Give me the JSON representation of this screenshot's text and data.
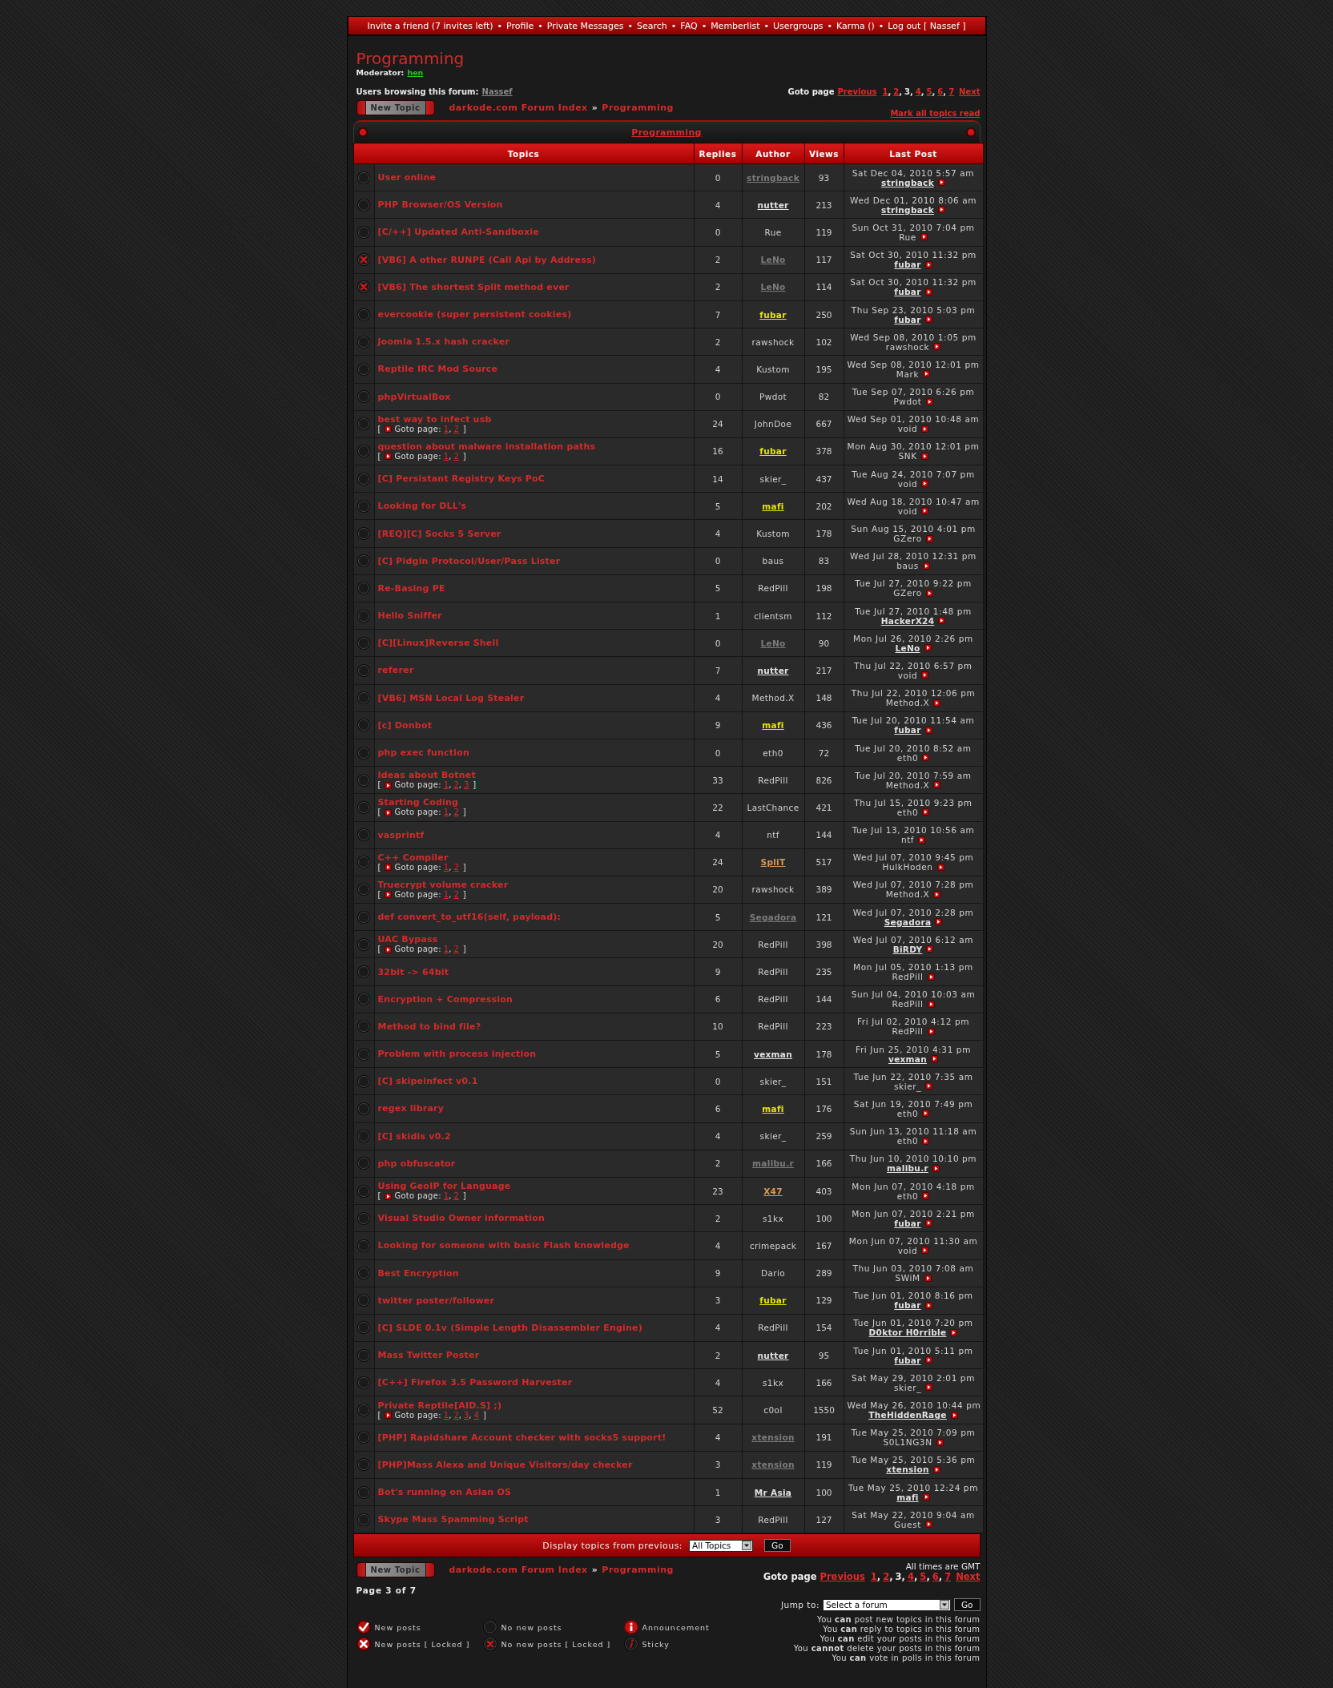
{
  "top_nav": {
    "separator": "•",
    "links": [
      "Invite a friend (7 invites left)",
      "Profile",
      "Private Messages",
      "Search",
      "FAQ",
      "Memberlist",
      "Usergroups",
      "Karma ()",
      "Log out [ Nassef ]"
    ]
  },
  "forum": {
    "title": "Programming",
    "moderator_label": "Moderator:",
    "moderator": "hen",
    "browsing_label": "Users browsing this forum:",
    "browsing_users": [
      "Nassef"
    ]
  },
  "pagination_top": {
    "label": "Goto page",
    "previous": "Previous",
    "separator": ",",
    "pages": [
      {
        "label": "1",
        "selected": false
      },
      {
        "label": "2",
        "selected": false
      },
      {
        "label": "3",
        "selected": true
      },
      {
        "label": "4",
        "selected": false
      },
      {
        "label": "5",
        "selected": false
      },
      {
        "label": "6",
        "selected": false
      },
      {
        "label": "7",
        "selected": false
      }
    ],
    "next": "Next"
  },
  "toolbar_top": {
    "new_topic": "New Topic",
    "breadcrumb": {
      "separator": "»",
      "items": [
        "darkode.com Forum Index",
        "Programming"
      ]
    },
    "mark_read": "Mark all topics read"
  },
  "table": {
    "category": "Programming",
    "columns": [
      "Topics",
      "Replies",
      "Author",
      "Views",
      "Last Post"
    ],
    "rows": [
      {
        "title": "User online",
        "locked": false,
        "replies": "0",
        "author": {
          "name": "stringback",
          "linked": true,
          "color": "#7c7c7c"
        },
        "views": "93",
        "last_post": {
          "time": "Sat Dec 04, 2010 5:57 am",
          "by": "stringback",
          "linked": true
        }
      },
      {
        "title": "PHP Browser/OS Version",
        "locked": false,
        "replies": "4",
        "author": {
          "name": "nutter",
          "linked": true,
          "color": "#e2e2e2"
        },
        "views": "213",
        "last_post": {
          "time": "Wed Dec 01, 2010 8:06 am",
          "by": "stringback",
          "linked": true
        }
      },
      {
        "title": "[C/++] Updated Anti-Sandboxie",
        "locked": false,
        "replies": "0",
        "author": {
          "name": "Rue",
          "linked": false
        },
        "views": "119",
        "last_post": {
          "time": "Sun Oct 31, 2010 7:04 pm",
          "by": "Rue",
          "linked": false
        }
      },
      {
        "title": "[VB6] A other RUNPE (Call Api by Address)",
        "locked": true,
        "replies": "2",
        "author": {
          "name": "LeNo",
          "linked": true,
          "color": "#7c7c7c"
        },
        "views": "117",
        "last_post": {
          "time": "Sat Oct 30, 2010 11:32 pm",
          "by": "fubar",
          "linked": true
        }
      },
      {
        "title": "[VB6] The shortest Split method ever",
        "locked": true,
        "replies": "2",
        "author": {
          "name": "LeNo",
          "linked": true,
          "color": "#7c7c7c"
        },
        "views": "114",
        "last_post": {
          "time": "Sat Oct 30, 2010 11:32 pm",
          "by": "fubar",
          "linked": true
        }
      },
      {
        "title": "evercookie (super persistent cookies)",
        "locked": false,
        "replies": "7",
        "author": {
          "name": "fubar",
          "linked": true,
          "color": "#e6e600"
        },
        "views": "250",
        "last_post": {
          "time": "Thu Sep 23, 2010 5:03 pm",
          "by": "fubar",
          "linked": true
        }
      },
      {
        "title": "Joomla 1.5.x hash cracker",
        "locked": false,
        "replies": "2",
        "author": {
          "name": "rawshock",
          "linked": false
        },
        "views": "102",
        "last_post": {
          "time": "Wed Sep 08, 2010 1:05 pm",
          "by": "rawshock",
          "linked": false
        }
      },
      {
        "title": "Reptile IRC Mod Source",
        "locked": false,
        "replies": "4",
        "author": {
          "name": "Kustom",
          "linked": false
        },
        "views": "195",
        "last_post": {
          "time": "Wed Sep 08, 2010 12:01 pm",
          "by": "Mark",
          "linked": false
        }
      },
      {
        "title": "phpVirtualBox",
        "locked": false,
        "replies": "0",
        "author": {
          "name": "Pwdot",
          "linked": false
        },
        "views": "82",
        "last_post": {
          "time": "Tue Sep 07, 2010 6:26 pm",
          "by": "Pwdot",
          "linked": false
        }
      },
      {
        "title": "best way to infect usb",
        "locked": false,
        "pagination": {
          "open": "[",
          "label": "Goto page:",
          "separator": ",",
          "pages": [
            "1",
            "2"
          ],
          "close": "]"
        },
        "replies": "24",
        "author": {
          "name": "JohnDoe",
          "linked": false
        },
        "views": "667",
        "last_post": {
          "time": "Wed Sep 01, 2010 10:48 am",
          "by": "void",
          "linked": false
        }
      },
      {
        "title": "question about malware installation paths",
        "locked": false,
        "pagination": {
          "open": "[",
          "label": "Goto page:",
          "separator": ",",
          "pages": [
            "1",
            "2"
          ],
          "close": "]"
        },
        "replies": "16",
        "author": {
          "name": "fubar",
          "linked": true,
          "color": "#e6e600"
        },
        "views": "378",
        "last_post": {
          "time": "Mon Aug 30, 2010 12:01 pm",
          "by": "SNK",
          "linked": false
        }
      },
      {
        "title": "[C] Persistant Registry Keys PoC",
        "locked": false,
        "replies": "14",
        "author": {
          "name": "skier_",
          "linked": false
        },
        "views": "437",
        "last_post": {
          "time": "Tue Aug 24, 2010 7:07 pm",
          "by": "void",
          "linked": false
        }
      },
      {
        "title": "Looking for DLL's",
        "locked": false,
        "replies": "5",
        "author": {
          "name": "mafi",
          "linked": true,
          "color": "#e6e600"
        },
        "views": "202",
        "last_post": {
          "time": "Wed Aug 18, 2010 10:47 am",
          "by": "void",
          "linked": false
        }
      },
      {
        "title": "[REQ][C] Socks 5 Server",
        "locked": false,
        "replies": "4",
        "author": {
          "name": "Kustom",
          "linked": false
        },
        "views": "178",
        "last_post": {
          "time": "Sun Aug 15, 2010 4:01 pm",
          "by": "GZero",
          "linked": false
        }
      },
      {
        "title": "[C] Pidgin Protocol/User/Pass Lister",
        "locked": false,
        "replies": "0",
        "author": {
          "name": "baus",
          "linked": false
        },
        "views": "83",
        "last_post": {
          "time": "Wed Jul 28, 2010 12:31 pm",
          "by": "baus",
          "linked": false
        }
      },
      {
        "title": "Re-Basing PE",
        "locked": false,
        "replies": "5",
        "author": {
          "name": "RedPill",
          "linked": false
        },
        "views": "198",
        "last_post": {
          "time": "Tue Jul 27, 2010 9:22 pm",
          "by": "GZero",
          "linked": false
        }
      },
      {
        "title": "Hello Sniffer",
        "locked": false,
        "replies": "1",
        "author": {
          "name": "clientsm",
          "linked": false
        },
        "views": "112",
        "last_post": {
          "time": "Tue Jul 27, 2010 1:48 pm",
          "by": "HackerX24",
          "linked": true
        }
      },
      {
        "title": "[C][Linux]Reverse Shell",
        "locked": false,
        "replies": "0",
        "author": {
          "name": "LeNo",
          "linked": true,
          "color": "#7c7c7c"
        },
        "views": "90",
        "last_post": {
          "time": "Mon Jul 26, 2010 2:26 pm",
          "by": "LeNo",
          "linked": true
        }
      },
      {
        "title": "referer",
        "locked": false,
        "replies": "7",
        "author": {
          "name": "nutter",
          "linked": true,
          "color": "#e2e2e2"
        },
        "views": "217",
        "last_post": {
          "time": "Thu Jul 22, 2010 6:57 pm",
          "by": "void",
          "linked": false
        }
      },
      {
        "title": "[VB6] MSN Local Log Stealer",
        "locked": false,
        "replies": "4",
        "author": {
          "name": "Method.X",
          "linked": false
        },
        "views": "148",
        "last_post": {
          "time": "Thu Jul 22, 2010 12:06 pm",
          "by": "Method.X",
          "linked": false
        }
      },
      {
        "title": "[c] Donbot",
        "locked": false,
        "replies": "9",
        "author": {
          "name": "mafi",
          "linked": true,
          "color": "#e6e600"
        },
        "views": "436",
        "last_post": {
          "time": "Tue Jul 20, 2010 11:54 am",
          "by": "fubar",
          "linked": true
        }
      },
      {
        "title": "php exec function",
        "locked": false,
        "replies": "0",
        "author": {
          "name": "eth0",
          "linked": false
        },
        "views": "72",
        "last_post": {
          "time": "Tue Jul 20, 2010 8:52 am",
          "by": "eth0",
          "linked": false
        }
      },
      {
        "title": "Ideas about Botnet",
        "locked": false,
        "pagination": {
          "open": "[",
          "label": "Goto page:",
          "separator": ",",
          "pages": [
            "1",
            "2",
            "3"
          ],
          "close": "]"
        },
        "replies": "33",
        "author": {
          "name": "RedPill",
          "linked": false
        },
        "views": "826",
        "last_post": {
          "time": "Tue Jul 20, 2010 7:59 am",
          "by": "Method.X",
          "linked": false
        }
      },
      {
        "title": "Starting Coding",
        "locked": false,
        "pagination": {
          "open": "[",
          "label": "Goto page:",
          "separator": ",",
          "pages": [
            "1",
            "2"
          ],
          "close": "]"
        },
        "replies": "22",
        "author": {
          "name": "LastChance",
          "linked": false
        },
        "views": "421",
        "last_post": {
          "time": "Thu Jul 15, 2010 9:23 pm",
          "by": "eth0",
          "linked": false
        }
      },
      {
        "title": "vasprintf",
        "locked": false,
        "replies": "4",
        "author": {
          "name": "ntf",
          "linked": false
        },
        "views": "144",
        "last_post": {
          "time": "Tue Jul 13, 2010 10:56 am",
          "by": "ntf",
          "linked": false
        }
      },
      {
        "title": "C++ Compiler",
        "locked": false,
        "pagination": {
          "open": "[",
          "label": "Goto page:",
          "separator": ",",
          "pages": [
            "1",
            "2"
          ],
          "close": "]"
        },
        "replies": "24",
        "author": {
          "name": "SpliT",
          "linked": true,
          "color": "#d49a58"
        },
        "views": "517",
        "last_post": {
          "time": "Wed Jul 07, 2010 9:45 pm",
          "by": "HulkHoden",
          "linked": false
        }
      },
      {
        "title": "Truecrypt volume cracker",
        "locked": false,
        "pagination": {
          "open": "[",
          "label": "Goto page:",
          "separator": ",",
          "pages": [
            "1",
            "2"
          ],
          "close": "]"
        },
        "replies": "20",
        "author": {
          "name": "rawshock",
          "linked": false
        },
        "views": "389",
        "last_post": {
          "time": "Wed Jul 07, 2010 7:28 pm",
          "by": "Method.X",
          "linked": false
        }
      },
      {
        "title": "def convert_to_utf16(self, payload):",
        "locked": false,
        "replies": "5",
        "author": {
          "name": "Segadora",
          "linked": true,
          "color": "#7c7c7c"
        },
        "views": "121",
        "last_post": {
          "time": "Wed Jul 07, 2010 2:28 pm",
          "by": "Segadora",
          "linked": true
        }
      },
      {
        "title": "UAC Bypass",
        "locked": false,
        "pagination": {
          "open": "[",
          "label": "Goto page:",
          "separator": ",",
          "pages": [
            "1",
            "2"
          ],
          "close": "]"
        },
        "replies": "20",
        "author": {
          "name": "RedPill",
          "linked": false
        },
        "views": "398",
        "last_post": {
          "time": "Wed Jul 07, 2010 6:12 am",
          "by": "BiRDY",
          "linked": true
        }
      },
      {
        "title": "32bit -> 64bit",
        "locked": false,
        "replies": "9",
        "author": {
          "name": "RedPill",
          "linked": false
        },
        "views": "235",
        "last_post": {
          "time": "Mon Jul 05, 2010 1:13 pm",
          "by": "RedPill",
          "linked": false
        }
      },
      {
        "title": "Encryption + Compression",
        "locked": false,
        "replies": "6",
        "author": {
          "name": "RedPill",
          "linked": false
        },
        "views": "144",
        "last_post": {
          "time": "Sun Jul 04, 2010 10:03 am",
          "by": "RedPill",
          "linked": false
        }
      },
      {
        "title": "Method to bind file?",
        "locked": false,
        "replies": "10",
        "author": {
          "name": "RedPill",
          "linked": false
        },
        "views": "223",
        "last_post": {
          "time": "Fri Jul 02, 2010 4:12 pm",
          "by": "RedPill",
          "linked": false
        }
      },
      {
        "title": "Problem with process injection",
        "locked": false,
        "replies": "5",
        "author": {
          "name": "vexman",
          "linked": true,
          "color": "#e2e2e2"
        },
        "views": "178",
        "last_post": {
          "time": "Fri Jun 25, 2010 4:31 pm",
          "by": "vexman",
          "linked": true
        }
      },
      {
        "title": "[C] skipeinfect v0.1",
        "locked": false,
        "replies": "0",
        "author": {
          "name": "skier_",
          "linked": false
        },
        "views": "151",
        "last_post": {
          "time": "Tue Jun 22, 2010 7:35 am",
          "by": "skier_",
          "linked": false
        }
      },
      {
        "title": "regex library",
        "locked": false,
        "replies": "6",
        "author": {
          "name": "mafi",
          "linked": true,
          "color": "#e6e600"
        },
        "views": "176",
        "last_post": {
          "time": "Sat Jun 19, 2010 7:49 pm",
          "by": "eth0",
          "linked": false
        }
      },
      {
        "title": "[C] skidis v0.2",
        "locked": false,
        "replies": "4",
        "author": {
          "name": "skier_",
          "linked": false
        },
        "views": "259",
        "last_post": {
          "time": "Sun Jun 13, 2010 11:18 am",
          "by": "eth0",
          "linked": false
        }
      },
      {
        "title": "php obfuscator",
        "locked": false,
        "replies": "2",
        "author": {
          "name": "malibu.r",
          "linked": true,
          "color": "#7c7c7c"
        },
        "views": "166",
        "last_post": {
          "time": "Thu Jun 10, 2010 10:10 pm",
          "by": "malibu.r",
          "linked": true
        }
      },
      {
        "title": "Using GeoIP for Language",
        "locked": false,
        "pagination": {
          "open": "[",
          "label": "Goto page:",
          "separator": ",",
          "pages": [
            "1",
            "2"
          ],
          "close": "]"
        },
        "replies": "23",
        "author": {
          "name": "X47",
          "linked": true,
          "color": "#d49a58"
        },
        "views": "403",
        "last_post": {
          "time": "Mon Jun 07, 2010 4:18 pm",
          "by": "eth0",
          "linked": false
        }
      },
      {
        "title": "Visual Studio Owner information",
        "locked": false,
        "replies": "2",
        "author": {
          "name": "s1kx",
          "linked": false
        },
        "views": "100",
        "last_post": {
          "time": "Mon Jun 07, 2010 2:21 pm",
          "by": "fubar",
          "linked": true
        }
      },
      {
        "title": "Looking for someone with basic Flash knowledge",
        "locked": false,
        "replies": "4",
        "author": {
          "name": "crimepack",
          "linked": false
        },
        "views": "167",
        "last_post": {
          "time": "Mon Jun 07, 2010 11:30 am",
          "by": "void",
          "linked": false
        }
      },
      {
        "title": "Best Encryption",
        "locked": false,
        "replies": "9",
        "author": {
          "name": "Dario",
          "linked": false
        },
        "views": "289",
        "last_post": {
          "time": "Thu Jun 03, 2010 7:08 am",
          "by": "SWiM",
          "linked": false
        }
      },
      {
        "title": "twitter poster/follower",
        "locked": false,
        "replies": "3",
        "author": {
          "name": "fubar",
          "linked": true,
          "color": "#e6e600"
        },
        "views": "129",
        "last_post": {
          "time": "Tue Jun 01, 2010 8:16 pm",
          "by": "fubar",
          "linked": true
        }
      },
      {
        "title": "[C] SLDE 0.1v (Simple Length Disassembler Engine)",
        "locked": false,
        "replies": "4",
        "author": {
          "name": "RedPill",
          "linked": false
        },
        "views": "154",
        "last_post": {
          "time": "Tue Jun 01, 2010 7:20 pm",
          "by": "D0ktor H0rrible",
          "linked": true
        }
      },
      {
        "title": "Mass Twitter Poster",
        "locked": false,
        "replies": "2",
        "author": {
          "name": "nutter",
          "linked": true,
          "color": "#e2e2e2"
        },
        "views": "95",
        "last_post": {
          "time": "Tue Jun 01, 2010 5:11 pm",
          "by": "fubar",
          "linked": true
        }
      },
      {
        "title": "[C++] Firefox 3.5 Password Harvester",
        "locked": false,
        "replies": "4",
        "author": {
          "name": "s1kx",
          "linked": false
        },
        "views": "166",
        "last_post": {
          "time": "Sat May 29, 2010 2:01 pm",
          "by": "skier_",
          "linked": false
        }
      },
      {
        "title": "Private Reptile[AID.S] ;)",
        "locked": false,
        "pagination": {
          "open": "[",
          "label": "Goto page:",
          "separator": ",",
          "pages": [
            "1",
            "2",
            "3",
            "4"
          ],
          "close": "]"
        },
        "replies": "52",
        "author": {
          "name": "c0ol",
          "linked": false
        },
        "views": "1550",
        "last_post": {
          "time": "Wed May 26, 2010 10:44 pm",
          "by": "TheHiddenRage",
          "linked": true
        }
      },
      {
        "title": "[PHP] Rapidshare Account checker with socks5 support!",
        "locked": false,
        "replies": "4",
        "author": {
          "name": "xtension",
          "linked": true,
          "color": "#7c7c7c"
        },
        "views": "191",
        "last_post": {
          "time": "Tue May 25, 2010 7:09 pm",
          "by": "S0L1NG3N",
          "linked": false
        }
      },
      {
        "title": "[PHP]Mass Alexa and Unique Visitors/day checker",
        "locked": false,
        "replies": "3",
        "author": {
          "name": "xtension",
          "linked": true,
          "color": "#7c7c7c"
        },
        "views": "119",
        "last_post": {
          "time": "Tue May 25, 2010 5:36 pm",
          "by": "xtension",
          "linked": true
        }
      },
      {
        "title": "Bot's running on Asian OS",
        "locked": false,
        "replies": "1",
        "author": {
          "name": "Mr Asia",
          "linked": true,
          "color": "#e2e2e2"
        },
        "views": "100",
        "last_post": {
          "time": "Tue May 25, 2010 12:24 pm",
          "by": "mafi",
          "linked": true
        }
      },
      {
        "title": "Skype Mass Spamming Script",
        "locked": false,
        "replies": "3",
        "author": {
          "name": "RedPill",
          "linked": false
        },
        "views": "127",
        "last_post": {
          "time": "Sat May 22, 2010 9:04 am",
          "by": "Guest",
          "linked": false
        }
      }
    ]
  },
  "filter": {
    "label": "Display topics from previous:",
    "value": "All Topics",
    "button": "Go"
  },
  "toolbar_bottom": {
    "new_topic": "New Topic",
    "breadcrumb": {
      "separator": "»",
      "items": [
        "darkode.com Forum Index",
        "Programming"
      ]
    },
    "timezone": "All times are GMT"
  },
  "pagination_bottom": {
    "label": "Goto page",
    "previous": "Previous",
    "separator": ",",
    "pages": [
      {
        "label": "1",
        "selected": false
      },
      {
        "label": "2",
        "selected": false
      },
      {
        "label": "3",
        "selected": true
      },
      {
        "label": "4",
        "selected": false
      },
      {
        "label": "5",
        "selected": false
      },
      {
        "label": "6",
        "selected": false
      },
      {
        "label": "7",
        "selected": false
      }
    ],
    "next": "Next"
  },
  "page_info": "Page 3 of 7",
  "jump": {
    "label": "Jump to:",
    "value": "Select a forum",
    "button": "Go"
  },
  "legend": [
    {
      "kind": "new",
      "label": "New posts"
    },
    {
      "kind": "none",
      "label": "No new posts"
    },
    {
      "kind": "announcement",
      "label": "Announcement"
    },
    {
      "kind": "new_locked",
      "label": "New posts [ Locked ]"
    },
    {
      "kind": "none_locked",
      "label": "No new posts [ Locked ]"
    },
    {
      "kind": "sticky",
      "label": "Sticky"
    }
  ],
  "permissions": [
    "You **can** post new topics in this forum",
    "You **can** reply to topics in this forum",
    "You **can** edit your posts in this forum",
    "You **cannot** delete your posts in this forum",
    "You **can** vote in polls in this forum"
  ]
}
